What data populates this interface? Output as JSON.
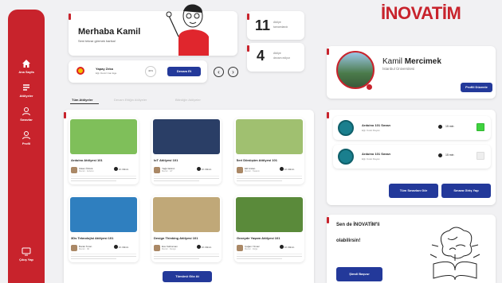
{
  "brand": {
    "logo": "İNOVATİM"
  },
  "sidebar": {
    "items": [
      {
        "label": "Ana Sayfa",
        "icon": "home-icon"
      },
      {
        "label": "Atölyeler",
        "icon": "workshop-icon"
      },
      {
        "label": "Sınavlar",
        "icon": "exam-icon"
      },
      {
        "label": "Profil",
        "icon": "profile-icon"
      }
    ],
    "logout": "Çıkış Yap"
  },
  "greeting": {
    "title": "Merhaba Kamil",
    "subtitle": "Seni tekrar görmek harika!"
  },
  "stats": [
    {
      "value": "11",
      "line1": "Atölye",
      "line2": "tamamlandı"
    },
    {
      "value": "4",
      "line1": "Atölye",
      "line2": "devam ediyor"
    }
  ],
  "current": {
    "title": "Yapay Zeka",
    "subtitle": "Eğt. Deniz Can Ege",
    "progress": "40%",
    "button": "Devam Et"
  },
  "tabs": [
    "Tüm Atölyeler",
    "Devam Ettiğin Atölyeler",
    "Bitirdiğin Atölyeler"
  ],
  "courses": [
    {
      "title": "Arduino Atölyesi 101",
      "teacher": "Utkan Öztürk",
      "desc": "Mentor · Arduino",
      "duration": "1h 30min",
      "color": "#7fbf5a"
    },
    {
      "title": "IoT Atölyesi 101",
      "teacher": "Yağız Ekinci",
      "desc": "Mentor · IoT",
      "duration": "1h 30min",
      "color": "#2a3e66"
    },
    {
      "title": "İleri Dönüşüm Atölyesi 101",
      "teacher": "Elif Arslan",
      "desc": "Mentor · Tasarım",
      "duration": "1h 30min",
      "color": "#a0c070"
    },
    {
      "title": "3Ds Teknolojisi Atölyesi 101",
      "teacher": "Burak Turan",
      "desc": "Mentor · 3D",
      "duration": "1h 30min",
      "color": "#2f7fbf"
    },
    {
      "title": "Design Thinking Atölyesi 101",
      "teacher": "Ece Kahraman",
      "desc": "Mentor · Design",
      "duration": "1h 30min",
      "color": "#c0a878"
    },
    {
      "title": "Gezeyde Yaşam Atölyesi 101",
      "teacher": "Çağan Yılmaz",
      "desc": "Mentor · Doğa",
      "duration": "1h 30min",
      "color": "#5a8a3a"
    }
  ],
  "all_button": "Tümünü Göz At",
  "profile": {
    "name_first": "Kamil",
    "name_last": "Mercimek",
    "university": "İstanbul Üniversitesi",
    "button": "Profili Düzenle"
  },
  "exams": [
    {
      "title": "Arduino 101 Sınavı",
      "teacher": "Eğt. Kutut Dayan",
      "duration": "15 min",
      "done": true
    },
    {
      "title": "Arduino 101 Sınavı",
      "teacher": "Eğt. Kutut Dayan",
      "duration": "15 min",
      "done": false
    }
  ],
  "exam_buttons": {
    "all": "Tüm Sınavları Gör",
    "start": "Sınava Giriş Yap"
  },
  "promo": {
    "line1": "Sen de İNOVATİM'li",
    "line2": "olabilirsin!",
    "button": "Şimdi Başvur"
  },
  "colors": {
    "brand_red": "#c8232c",
    "navy": "#23399a"
  }
}
